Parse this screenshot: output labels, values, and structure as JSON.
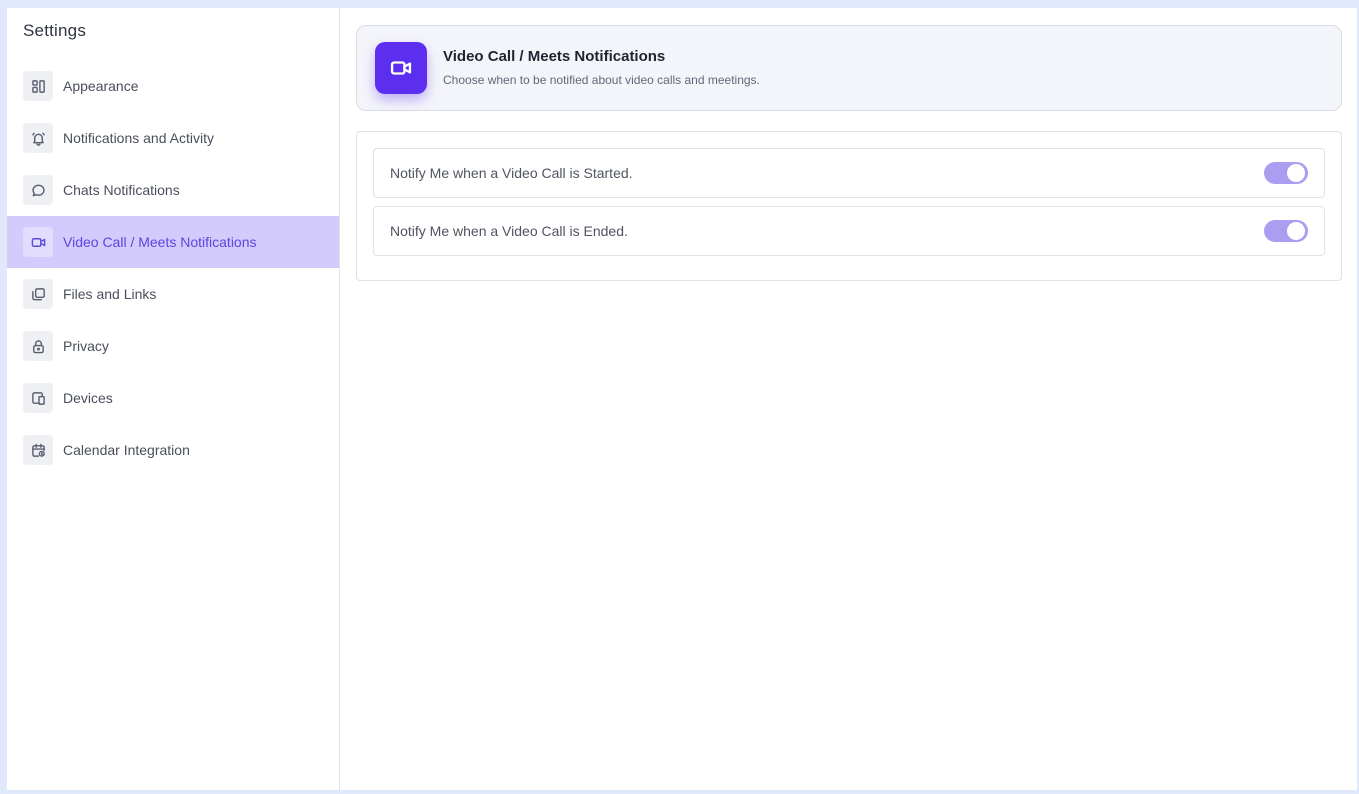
{
  "sidebar": {
    "title": "Settings",
    "items": [
      {
        "label": "Appearance",
        "icon": "layout-icon"
      },
      {
        "label": "Notifications and Activity",
        "icon": "bell-icon"
      },
      {
        "label": "Chats Notifications",
        "icon": "chat-bubble-icon"
      },
      {
        "label": "Video Call / Meets Notifications",
        "icon": "video-camera-icon",
        "active": true
      },
      {
        "label": "Files and Links",
        "icon": "files-icon"
      },
      {
        "label": "Privacy",
        "icon": "lock-icon"
      },
      {
        "label": "Devices",
        "icon": "devices-icon"
      },
      {
        "label": "Calendar Integration",
        "icon": "calendar-icon"
      }
    ]
  },
  "header": {
    "title": "Video Call / Meets Notifications",
    "subtitle": "Choose when to be notified about video calls and meetings.",
    "icon": "video-camera-icon"
  },
  "options": [
    {
      "label": "Notify Me when a Video Call is Started.",
      "enabled": true
    },
    {
      "label": "Notify Me when a Video Call is Ended.",
      "enabled": true
    }
  ],
  "colors": {
    "accent": "#5b2ef0",
    "active_nav_bg": "#d3cbfb",
    "toggle_on": "#ab9df0"
  }
}
